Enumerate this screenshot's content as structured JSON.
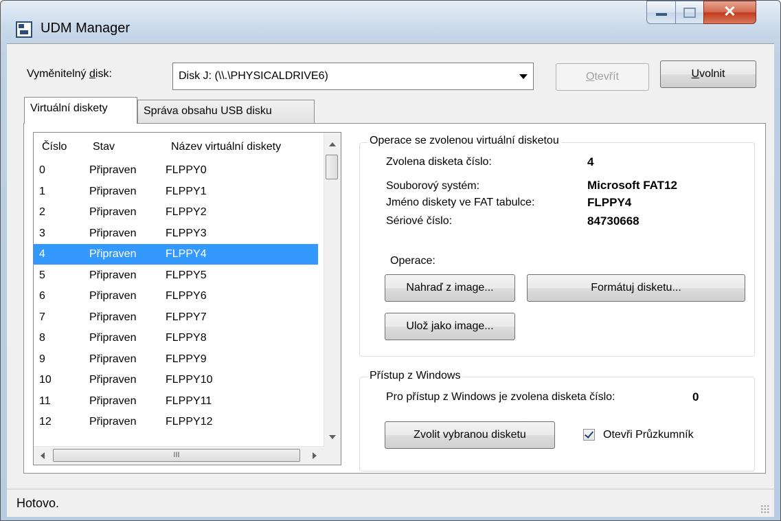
{
  "window": {
    "title": "UDM Manager"
  },
  "toolbar": {
    "drive_label_pre": "Vyměnitelný ",
    "drive_label_key": "d",
    "drive_label_post": "isk:",
    "drive_selected": "Disk J: (\\\\.\\PHYSICALDRIVE6)",
    "open_key": "O",
    "open_rest": "tevřít",
    "release_key": "U",
    "release_rest": "volnit"
  },
  "tabs": [
    {
      "label": "Virtuální diskety"
    },
    {
      "label": "Správa obsahu USB disku"
    }
  ],
  "list": {
    "columns": [
      "Číslo",
      "Stav",
      "Název virtuální diskety"
    ],
    "rows": [
      {
        "num": "0",
        "state": "Připraven",
        "name": "FLPPY0"
      },
      {
        "num": "1",
        "state": "Připraven",
        "name": "FLPPY1"
      },
      {
        "num": "2",
        "state": "Připraven",
        "name": "FLPPY2"
      },
      {
        "num": "3",
        "state": "Připraven",
        "name": "FLPPY3"
      },
      {
        "num": "4",
        "state": "Připraven",
        "name": "FLPPY4"
      },
      {
        "num": "5",
        "state": "Připraven",
        "name": "FLPPY5"
      },
      {
        "num": "6",
        "state": "Připraven",
        "name": "FLPPY6"
      },
      {
        "num": "7",
        "state": "Připraven",
        "name": "FLPPY7"
      },
      {
        "num": "8",
        "state": "Připraven",
        "name": "FLPPY8"
      },
      {
        "num": "9",
        "state": "Připraven",
        "name": "FLPPY9"
      },
      {
        "num": "10",
        "state": "Připraven",
        "name": "FLPPY10"
      },
      {
        "num": "11",
        "state": "Připraven",
        "name": "FLPPY11"
      },
      {
        "num": "12",
        "state": "Připraven",
        "name": "FLPPY12"
      }
    ],
    "selected_index": 4,
    "hscroll_grip": "III"
  },
  "operations": {
    "group_title": "Operace se zvolenou virtuální disketou",
    "selected_label": "Zvolena disketa číslo:",
    "selected_value": "4",
    "fs_label": "Souborový systém:",
    "fs_value": "Microsoft FAT12",
    "fatname_label": "Jméno diskety ve FAT tabulce:",
    "fatname_value": "FLPPY4",
    "serial_label": "Sériové číslo:",
    "serial_value": "84730668",
    "ops_label": "Operace:",
    "replace_button": "Nahraď z image...",
    "format_button": "Formátuj disketu...",
    "save_button": "Ulož jako image..."
  },
  "windows_access": {
    "group_title": "Přístup z Windows",
    "info_label": "Pro přístup z Windows je zvolena disketa číslo:",
    "info_value": "0",
    "select_button": "Zvolit vybranou disketu",
    "explorer_checkbox": "Otevři Průzkumník",
    "explorer_checked": true
  },
  "status": {
    "text": "Hotovo."
  },
  "colors": {
    "selection": "#3399ff",
    "close_button": "#c0391b"
  }
}
